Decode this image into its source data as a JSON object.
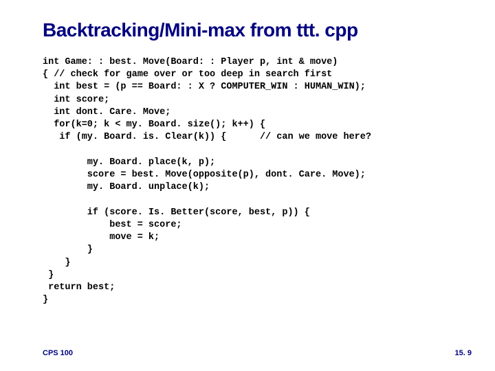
{
  "title": "Backtracking/Mini-max from ttt. cpp",
  "code": "int Game: : best. Move(Board: : Player p, int & move)\n{ // check for game over or too deep in search first\n  int best = (p == Board: : X ? COMPUTER_WIN : HUMAN_WIN);\n  int score;\n  int dont. Care. Move;\n  for(k=0; k < my. Board. size(); k++) {\n   if (my. Board. is. Clear(k)) {      // can we move here?\n\n        my. Board. place(k, p);\n        score = best. Move(opposite(p), dont. Care. Move);\n        my. Board. unplace(k);\n\n        if (score. Is. Better(score, best, p)) {\n            best = score;\n            move = k;\n        }\n    }\n }\n return best;\n}",
  "footer_left": "CPS 100",
  "footer_right": "15. 9"
}
